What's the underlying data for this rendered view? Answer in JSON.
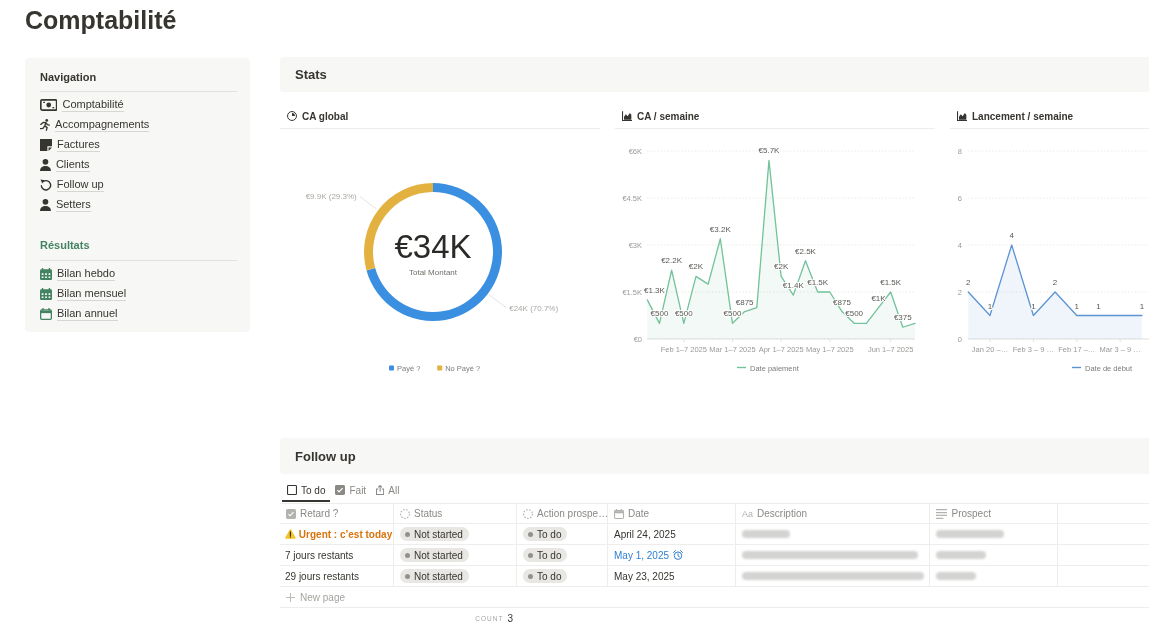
{
  "page": {
    "title": "Comptabilité"
  },
  "sidebar": {
    "navigation": {
      "heading": "Navigation",
      "items": [
        "Comptabilité",
        "Accompagnements",
        "Factures",
        "Clients",
        "Follow up",
        "Setters"
      ]
    },
    "results": {
      "heading": "Résultats",
      "items": [
        "Bilan hebdo",
        "Bilan mensuel",
        "Bilan annuel"
      ]
    }
  },
  "stats": {
    "heading": "Stats",
    "charts": [
      {
        "title": "CA global",
        "total": {
          "value": "€34K",
          "label": "Total Montant"
        },
        "chart_data": {
          "type": "donut",
          "categories": [
            "Payé ?",
            "No Payé ?"
          ],
          "values": [
            70.7,
            29.3
          ],
          "colors": [
            "#3b8fe0",
            "#e3b13f"
          ],
          "value_labels": [
            "€24K (70.7%)",
            "€9.9K (29.3%)"
          ],
          "legend": "bottom"
        }
      },
      {
        "title": "CA / semaine",
        "chart_data": {
          "type": "area",
          "categories": [
            null,
            null,
            null,
            "Feb 1–7 2025",
            null,
            null,
            null,
            "Mar 1–7 2025",
            null,
            null,
            null,
            "Apr 1–7 2025",
            null,
            null,
            null,
            "May 1–7 2025",
            null,
            null,
            null,
            null,
            "Jun 1–7 2025",
            null,
            null
          ],
          "series": [
            {
              "name": "Date paiement",
              "color": "#72c29b",
              "values": [
                1250,
                500,
                2200,
                500,
                2000,
                1750,
                3200,
                500,
                875,
                1000,
                5700,
                2000,
                1400,
                2500,
                1500,
                1500,
                875,
                500,
                500,
                1000,
                1500,
                375,
                500
              ]
            }
          ],
          "ylim": [
            0,
            6000
          ],
          "yticks": [
            {
              "value": 0,
              "label": "€0"
            },
            {
              "value": 1500,
              "label": "€1.5K"
            },
            {
              "value": 3000,
              "label": "€3K"
            },
            {
              "value": 4500,
              "label": "€4.5K"
            },
            {
              "value": 6000,
              "label": "€6K"
            }
          ],
          "grid": true,
          "legend": "bottom",
          "value_labels": [
            "€1.3K",
            "€500",
            "€2.2K",
            "€500",
            "€2K",
            null,
            "€3.2K",
            "€500",
            "€875",
            null,
            "€5.7K",
            "€2K",
            "€1.4K",
            "€2.5K",
            "€1.5K",
            null,
            "€875",
            "€500",
            null,
            "€1K",
            "€1.5K",
            "€375",
            null
          ]
        }
      },
      {
        "title": "Lancement / semaine",
        "chart_data": {
          "type": "area",
          "categories": [
            null,
            "Jan 20 –…",
            null,
            "Feb 3 – 9 …",
            null,
            "Feb 17 –…",
            null,
            "Mar 3 – 9 …",
            null
          ],
          "series": [
            {
              "name": "Date de début",
              "color": "#5b93d3",
              "values": [
                2,
                1,
                4,
                1,
                2,
                1,
                1,
                1,
                1
              ]
            }
          ],
          "ylim": [
            0,
            8
          ],
          "yticks": [
            0,
            2,
            4,
            6,
            8
          ],
          "grid": true,
          "legend": "bottom",
          "value_labels": [
            "2",
            "1",
            "4",
            "1",
            "2",
            "1",
            "1",
            null,
            "1"
          ]
        }
      }
    ]
  },
  "follow_up": {
    "heading": "Follow up",
    "tabs": [
      {
        "label": "To do",
        "selected": true
      },
      {
        "label": "Fait",
        "selected": false
      },
      {
        "label": "All",
        "selected": false
      }
    ],
    "table": {
      "columns": [
        {
          "label": "Retard ?",
          "kind": "formula"
        },
        {
          "label": "Status",
          "kind": "status"
        },
        {
          "label": "Action prospe…",
          "kind": "status"
        },
        {
          "label": "Date",
          "kind": "date"
        },
        {
          "label": "Description",
          "kind": "title",
          "glyph": "Aa"
        },
        {
          "label": "Prospect",
          "kind": "text"
        }
      ],
      "rows": [
        {
          "retard": {
            "text": "Urgent : c’est today",
            "urgent": true
          },
          "status": "Not started",
          "action": "To do",
          "date": {
            "text": "April 24, 2025",
            "reminder": false
          },
          "description": {
            "blurred": true
          },
          "prospect": {
            "blurred": true
          }
        },
        {
          "retard": {
            "text": "7 jours restants",
            "urgent": false
          },
          "status": "Not started",
          "action": "To do",
          "date": {
            "text": "May 1, 2025",
            "reminder": true
          },
          "description": {
            "blurred": true
          },
          "prospect": {
            "blurred": true
          }
        },
        {
          "retard": {
            "text": "29 jours restants",
            "urgent": false
          },
          "status": "Not started",
          "action": "To do",
          "date": {
            "text": "May 23, 2025",
            "reminder": false
          },
          "description": {
            "blurred": true
          },
          "prospect": {
            "blurred": true
          }
        }
      ]
    },
    "new_row": "New page",
    "footer": {
      "label": "COUNT",
      "value": "3"
    }
  }
}
